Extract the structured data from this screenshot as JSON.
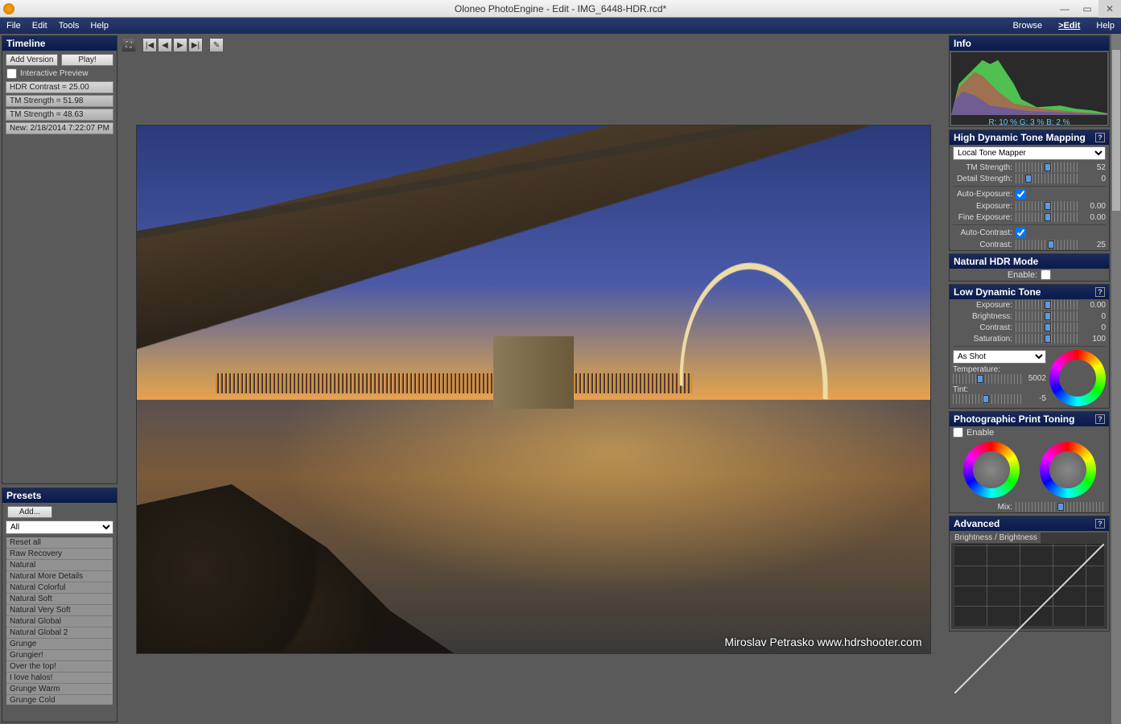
{
  "titlebar": {
    "title": "Oloneo PhotoEngine - Edit - IMG_6448-HDR.rcd*"
  },
  "menubar": {
    "left": [
      "File",
      "Edit",
      "Tools",
      "Help"
    ],
    "right": [
      "Browse",
      "Edit",
      "Help"
    ]
  },
  "timeline": {
    "title": "Timeline",
    "add": "Add Version",
    "play": "Play!",
    "interactive": "Interactive Preview",
    "items": [
      "HDR Contrast = 25.00",
      "TM Strength = 51.98",
      "TM Strength = 48.63",
      "New: 2/18/2014 7:22:07 PM"
    ]
  },
  "presets": {
    "title": "Presets",
    "add": "Add...",
    "filter": "All",
    "items": [
      "Reset all",
      "Raw Recovery",
      "Natural",
      "Natural More Details",
      "Natural Colorful",
      "Natural Soft",
      "Natural Very Soft",
      "Natural Global",
      "Natural Global 2",
      "Grunge",
      "Grungier!",
      "Over the top!",
      "I love halos!",
      "Grunge Warm",
      "Grunge Cold"
    ]
  },
  "info": {
    "title": "Info",
    "readout": "R: 10 %     G: 3 %     B: 2 %"
  },
  "hdtm": {
    "title": "High Dynamic Tone Mapping",
    "mapper": "Local Tone Mapper",
    "tm_strength": {
      "label": "TM Strength:",
      "val": "52",
      "pos": 50
    },
    "detail": {
      "label": "Detail Strength:",
      "val": "0",
      "pos": 20
    },
    "autoexp": {
      "label": "Auto-Exposure:",
      "checked": true
    },
    "exposure": {
      "label": "Exposure:",
      "val": "0.00",
      "pos": 50
    },
    "fineexp": {
      "label": "Fine Exposure:",
      "val": "0.00",
      "pos": 50
    },
    "autocontrast": {
      "label": "Auto-Contrast:",
      "checked": true
    },
    "contrast": {
      "label": "Contrast:",
      "val": "25",
      "pos": 55
    }
  },
  "nhdr": {
    "title": "Natural HDR Mode",
    "enable": "Enable:"
  },
  "ldt": {
    "title": "Low Dynamic Tone",
    "exposure": {
      "label": "Exposure:",
      "val": "0.00",
      "pos": 50
    },
    "brightness": {
      "label": "Brightness:",
      "val": "0",
      "pos": 50
    },
    "contrast": {
      "label": "Contrast:",
      "val": "0",
      "pos": 50
    },
    "saturation": {
      "label": "Saturation:",
      "val": "100",
      "pos": 50
    }
  },
  "wb": {
    "preset": "As Shot",
    "temp": {
      "label": "Temperature:",
      "val": "5002",
      "pos": 40
    },
    "tint": {
      "label": "Tint:",
      "val": "-5",
      "pos": 48
    }
  },
  "ppt": {
    "title": "Photographic Print Toning",
    "enable": "Enable",
    "mix": {
      "label": "Mix:",
      "pos": 50
    }
  },
  "adv": {
    "title": "Advanced",
    "curve_tab": "Brightness / Brightness"
  },
  "watermark": "Miroslav Petrasko www.hdrshooter.com"
}
